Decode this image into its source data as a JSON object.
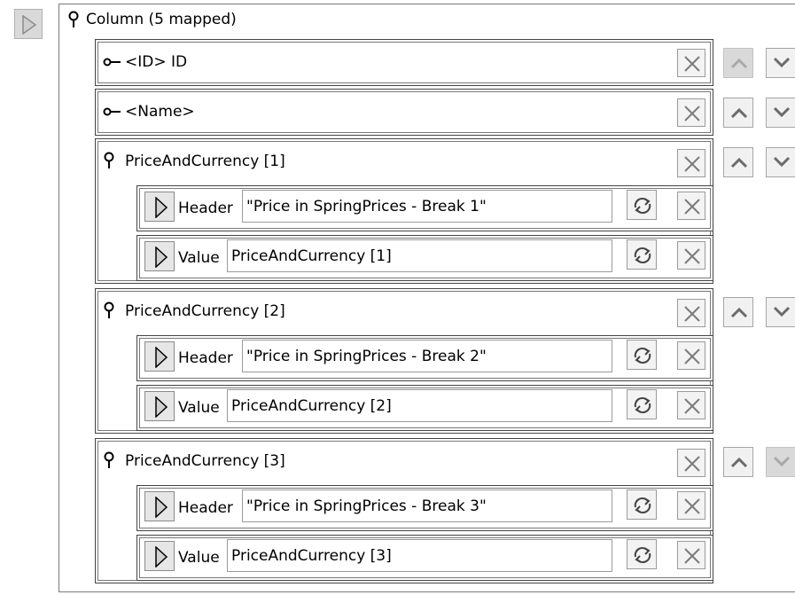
{
  "column": {
    "label": "Column (5 mapped)"
  },
  "rows": [
    {
      "label": "<ID> ID",
      "icon": "key-icon"
    },
    {
      "label": "<Name>",
      "icon": "key-icon"
    }
  ],
  "groups": [
    {
      "label": "PriceAndCurrency [1]",
      "header_label": "Header",
      "header_value": "\"Price in SpringPrices - Break 1\"",
      "value_label": "Value",
      "value_value": "PriceAndCurrency [1]"
    },
    {
      "label": "PriceAndCurrency [2]",
      "header_label": "Header",
      "header_value": "\"Price in SpringPrices - Break 2\"",
      "value_label": "Value",
      "value_value": "PriceAndCurrency [2]"
    },
    {
      "label": "PriceAndCurrency [3]",
      "header_label": "Header",
      "header_value": "\"Price in SpringPrices - Break 3\"",
      "value_label": "Value",
      "value_value": "PriceAndCurrency [3]"
    }
  ],
  "colors": {
    "border": "#444444",
    "button_bg": "#f3f3f3",
    "disabled_bg": "#d9d9d9",
    "arrow_color": "#6b6b6b"
  }
}
